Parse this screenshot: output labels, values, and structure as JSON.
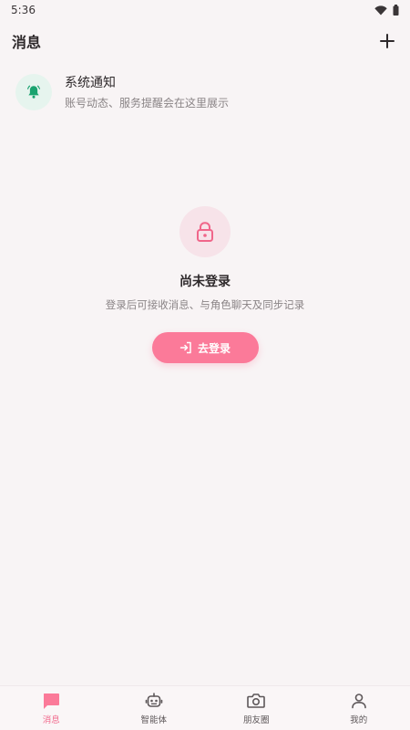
{
  "status_bar": {
    "time": "5:36",
    "icons": [
      "wifi-icon",
      "battery-icon"
    ]
  },
  "header": {
    "title": "消息",
    "add_icon": "plus-icon"
  },
  "notice": {
    "icon": "bell-icon",
    "title": "系统通知",
    "description": "账号动态、服务提醒会在这里展示"
  },
  "empty_state": {
    "icon": "lock-icon",
    "title": "尚未登录",
    "description": "登录后可接收消息、与角色聊天及同步记录",
    "button_icon": "login-icon",
    "button_label": "去登录"
  },
  "bottom_nav": {
    "items": [
      {
        "label": "消息",
        "icon": "chat-icon",
        "active": true
      },
      {
        "label": "智能体",
        "icon": "robot-icon",
        "active": false
      },
      {
        "label": "朋友圈",
        "icon": "camera-icon",
        "active": false
      },
      {
        "label": "我的",
        "icon": "person-icon",
        "active": false
      }
    ]
  },
  "colors": {
    "accent": "#fb7a99",
    "accent_text": "#f0668a",
    "notice_green": "#1aa36f",
    "background": "#f8f4f5"
  }
}
